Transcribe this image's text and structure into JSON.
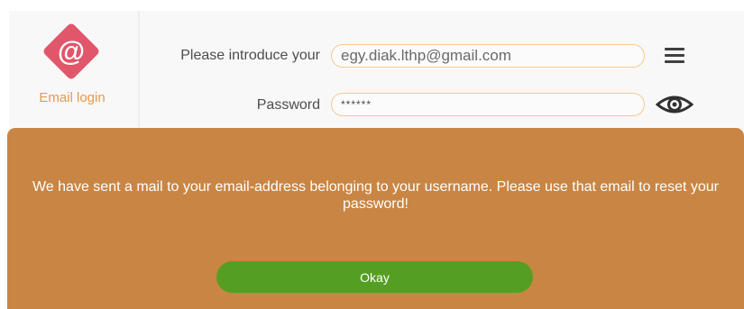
{
  "login": {
    "logo_symbol": "@",
    "logo_label": "Email login",
    "email_label": "Please introduce your",
    "email_value": "egy.diak.lthp@gmail.com",
    "password_label": "Password",
    "password_value": "******",
    "menu_icon": "hamburger-menu-icon",
    "eye_icon": "eye-icon"
  },
  "dialog": {
    "message": "We have sent a mail to your email-address belonging to your username. Please use that email to reset your password!",
    "button_label": "Okay"
  },
  "colors": {
    "accent_orange": "#c98543",
    "logo_red": "#e0566a",
    "label_orange": "#e39a4f",
    "field_border": "#f5c98f",
    "button_green": "#549f22"
  }
}
